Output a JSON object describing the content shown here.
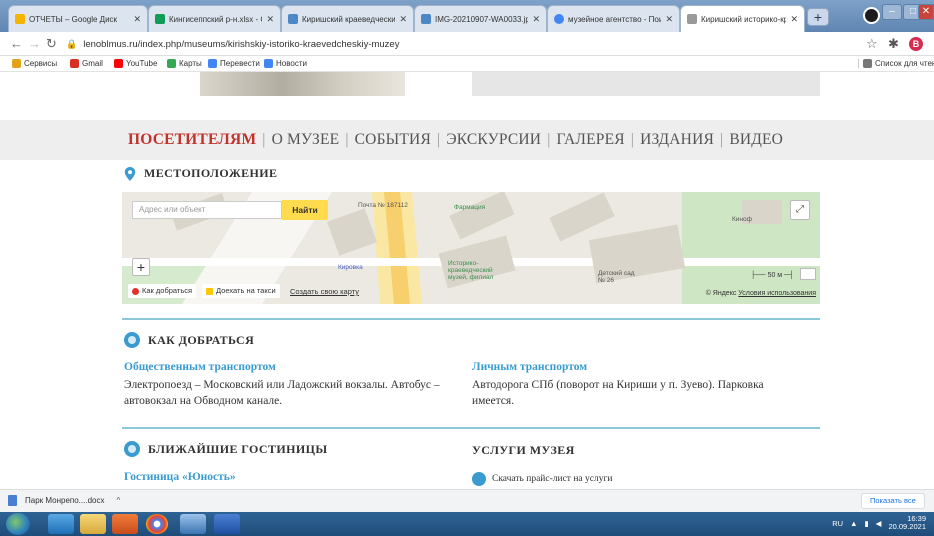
{
  "browser": {
    "tabs": [
      {
        "label": "ОТЧЕТЫ – Google Диск",
        "icon": "google-drive-icon",
        "color": "#f4b400"
      },
      {
        "label": "Кингисеппский р-н.xlsx - G",
        "icon": "sheets-icon",
        "color": "#0f9d58"
      },
      {
        "label": "Киришский краеведческий",
        "icon": "web-page-icon",
        "color": "#4b88c5"
      },
      {
        "label": "IMG-20210907-WA0033.jpg",
        "icon": "web-page-icon",
        "color": "#4b88c5"
      },
      {
        "label": "музейное агентство - Поис",
        "icon": "google-icon",
        "color": "#4285f4"
      },
      {
        "label": "Киришский историко-крае",
        "icon": "page-icon",
        "color": "#999999"
      }
    ],
    "address": "lenoblmus.ru/index.php/museums/kirishskiy-istoriko-kraevedcheskiy-muzey",
    "profile_letter": "B",
    "bookmarks": [
      {
        "label": "Сервисы",
        "icon": "apps-grid-icon",
        "color": "#e3a21a"
      },
      {
        "label": "Gmail",
        "icon": "gmail-icon",
        "color": "#d93025"
      },
      {
        "label": "YouTube",
        "icon": "youtube-icon",
        "color": "#ff0000"
      },
      {
        "label": "Карты",
        "icon": "maps-icon",
        "color": "#34a853"
      },
      {
        "label": "Перевести",
        "icon": "translate-icon",
        "color": "#4285f4"
      },
      {
        "label": "Новости",
        "icon": "news-icon",
        "color": "#4285f4"
      }
    ],
    "reading_list": "Список для чтени"
  },
  "nav": {
    "items": [
      "ПОСЕТИТЕЛЯМ",
      "О МУЗЕЕ",
      "СОБЫТИЯ",
      "ЭКСКУРСИИ",
      "ГАЛЕРЕЯ",
      "ИЗДАНИЯ",
      "ВИДЕО"
    ]
  },
  "location": {
    "title": "МЕСТОПОЛОЖЕНИЕ",
    "map": {
      "search_placeholder": "Адрес или объект",
      "find_button": "Найти",
      "route_button": "Как добраться",
      "taxi_button": "Доехать на такси",
      "create_map_link": "Создать свою карту",
      "labels": [
        "Почта № 187112",
        "Фармация",
        "Кировка",
        "Историко-краеведческий музей, филиал",
        "Детский сад № 26",
        "Киноф"
      ],
      "scale": "50 м",
      "copyright": "© Яндекс",
      "terms": "Условия использования"
    }
  },
  "directions": {
    "title": "КАК ДОБРАТЬСЯ",
    "public_head": "Общественным транспортом",
    "public_text": "Электропоезд – Московский или Ладожский вокзалы. Автобус – автовокзал на Обводном канале.",
    "private_head": "Личным транспортом",
    "private_text": "Автодорога СПб (поворот на Кириши у п. Зуево). Парковка имеется."
  },
  "hotels": {
    "title": "БЛИЖАЙШИЕ ГОСТИНИЦЫ",
    "first": "Гостиница «Юность»"
  },
  "services": {
    "title": "УСЛУГИ МУЗЕЯ",
    "download": "Скачать прайс-лист на услуги"
  },
  "downloads": {
    "file": "Парк Монрепо....docx",
    "show_all": "Показать все"
  },
  "taskbar": {
    "lang": "RU",
    "time": "16:39",
    "date": "20.09.2021"
  }
}
